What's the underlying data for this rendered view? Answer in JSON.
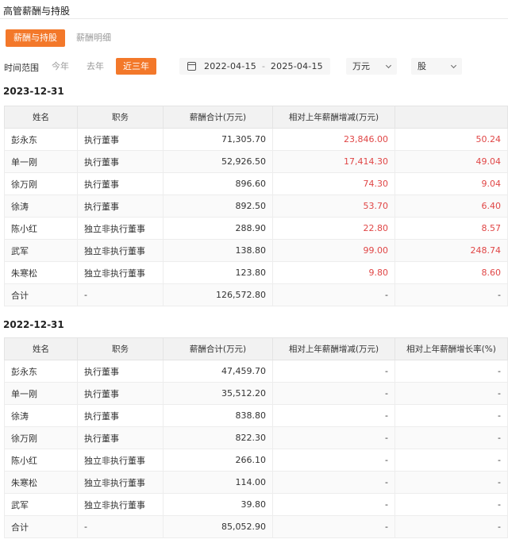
{
  "header": {
    "title": "高管薪酬与持股"
  },
  "tabs": [
    {
      "label": "薪酬与持股",
      "active": true
    },
    {
      "label": "薪酬明细",
      "active": false
    }
  ],
  "filter": {
    "label": "时间范围",
    "ranges": [
      {
        "label": "今年",
        "active": false
      },
      {
        "label": "去年",
        "active": false
      },
      {
        "label": "近三年",
        "active": true
      }
    ],
    "date_start": "2022-04-15",
    "date_sep": "-",
    "date_end": "2025-04-15",
    "unit_money": "万元",
    "unit_shares": "股"
  },
  "colors": {
    "accent": "#f3782a",
    "increase": "#e04646"
  },
  "tables": [
    {
      "date": "2023-12-31",
      "headers": [
        "姓名",
        "职务",
        "薪酬合计(万元)",
        "相对上年薪酬增减(万元)",
        ""
      ],
      "rows": [
        [
          "彭永东",
          "执行董事",
          "71,305.70",
          "23,846.00",
          "50.24"
        ],
        [
          "单一刚",
          "执行董事",
          "52,926.50",
          "17,414.30",
          "49.04"
        ],
        [
          "徐万刚",
          "执行董事",
          "896.60",
          "74.30",
          "9.04"
        ],
        [
          "徐涛",
          "执行董事",
          "892.50",
          "53.70",
          "6.40"
        ],
        [
          "陈小红",
          "独立非执行董事",
          "288.90",
          "22.80",
          "8.57"
        ],
        [
          "武军",
          "独立非执行董事",
          "138.80",
          "99.00",
          "248.74"
        ],
        [
          "朱寒松",
          "独立非执行董事",
          "123.80",
          "9.80",
          "8.60"
        ],
        [
          "合计",
          "-",
          "126,572.80",
          "-",
          "-"
        ]
      ]
    },
    {
      "date": "2022-12-31",
      "headers": [
        "姓名",
        "职务",
        "薪酬合计(万元)",
        "相对上年薪酬增减(万元)",
        "相对上年薪酬增长率(%)"
      ],
      "rows": [
        [
          "彭永东",
          "执行董事",
          "47,459.70",
          "-",
          "-"
        ],
        [
          "单一刚",
          "执行董事",
          "35,512.20",
          "-",
          "-"
        ],
        [
          "徐涛",
          "执行董事",
          "838.80",
          "-",
          "-"
        ],
        [
          "徐万刚",
          "执行董事",
          "822.30",
          "-",
          "-"
        ],
        [
          "陈小红",
          "独立非执行董事",
          "266.10",
          "-",
          "-"
        ],
        [
          "朱寒松",
          "独立非执行董事",
          "114.00",
          "-",
          "-"
        ],
        [
          "武军",
          "独立非执行董事",
          "39.80",
          "-",
          "-"
        ],
        [
          "合计",
          "-",
          "85,052.90",
          "-",
          "-"
        ]
      ]
    }
  ]
}
